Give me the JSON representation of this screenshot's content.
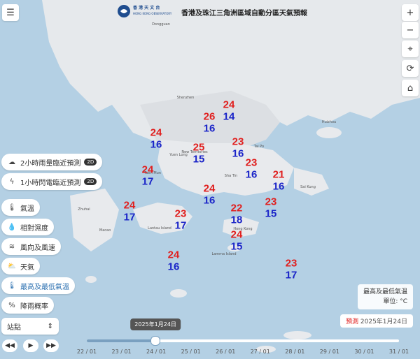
{
  "header": {
    "title": "香港及珠江三角洲區域自動分區天氣預報",
    "logo_cn": "香 港 天 文 台",
    "logo_en": "HONG KONG OBSERVATORY"
  },
  "left_panel": {
    "nowcast_rain": "2小時雨量臨近預測",
    "nowcast_lightning": "1小時閃電臨近預測",
    "badge": "2D",
    "items": [
      {
        "label": "氣溫",
        "icon": "thermometer-icon"
      },
      {
        "label": "相對濕度",
        "icon": "droplet-icon"
      },
      {
        "label": "風向及風速",
        "icon": "wind-icon"
      },
      {
        "label": "天氣",
        "icon": "cloud-sun-icon"
      },
      {
        "label": "最高及最低氣溫",
        "icon": "thermometers-icon"
      },
      {
        "label": "降雨概率",
        "icon": "percent-icon"
      }
    ],
    "station_select": "站點"
  },
  "right_controls": [
    "+",
    "−",
    "⌖",
    "⟳",
    "⌂"
  ],
  "legend": {
    "line1": "最高及最低氣溫",
    "line2": "單位: °C"
  },
  "forecast": {
    "tag": "預測",
    "date": "2025年1月24日"
  },
  "timeline": {
    "current_label": "2025年1月24日",
    "ticks": [
      "22 / 01",
      "23 / 01",
      "24 / 01",
      "25 / 01",
      "26 / 01",
      "27 / 01",
      "28 / 01",
      "29 / 01",
      "30 / 01",
      "31 / 01"
    ],
    "progress_fraction": 0.22
  },
  "temperatures": [
    {
      "max": "24",
      "min": "14"
    },
    {
      "max": "26",
      "min": "16"
    },
    {
      "max": "24",
      "min": "16"
    },
    {
      "max": "23",
      "min": "16"
    },
    {
      "max": "25",
      "min": "15"
    },
    {
      "max": "23",
      "min": "16"
    },
    {
      "max": "21",
      "min": "16"
    },
    {
      "max": "24",
      "min": "17"
    },
    {
      "max": "24",
      "min": "16"
    },
    {
      "max": "23",
      "min": "15"
    },
    {
      "max": "24",
      "min": "17"
    },
    {
      "max": "23",
      "min": "17"
    },
    {
      "max": "22",
      "min": "18"
    },
    {
      "max": "24",
      "min": "15"
    },
    {
      "max": "24",
      "min": "16"
    },
    {
      "max": "23",
      "min": "17"
    }
  ],
  "places": [
    "Huizhou",
    "Dongguan",
    "Shenzhen",
    "Tuen Mun",
    "Yuen Long",
    "Sha Tin",
    "Sai Kung",
    "Tai Po",
    "New Territories",
    "Lantau Island",
    "Hong Kong",
    "Macao",
    "Zhuhai",
    "Lamma Island"
  ]
}
